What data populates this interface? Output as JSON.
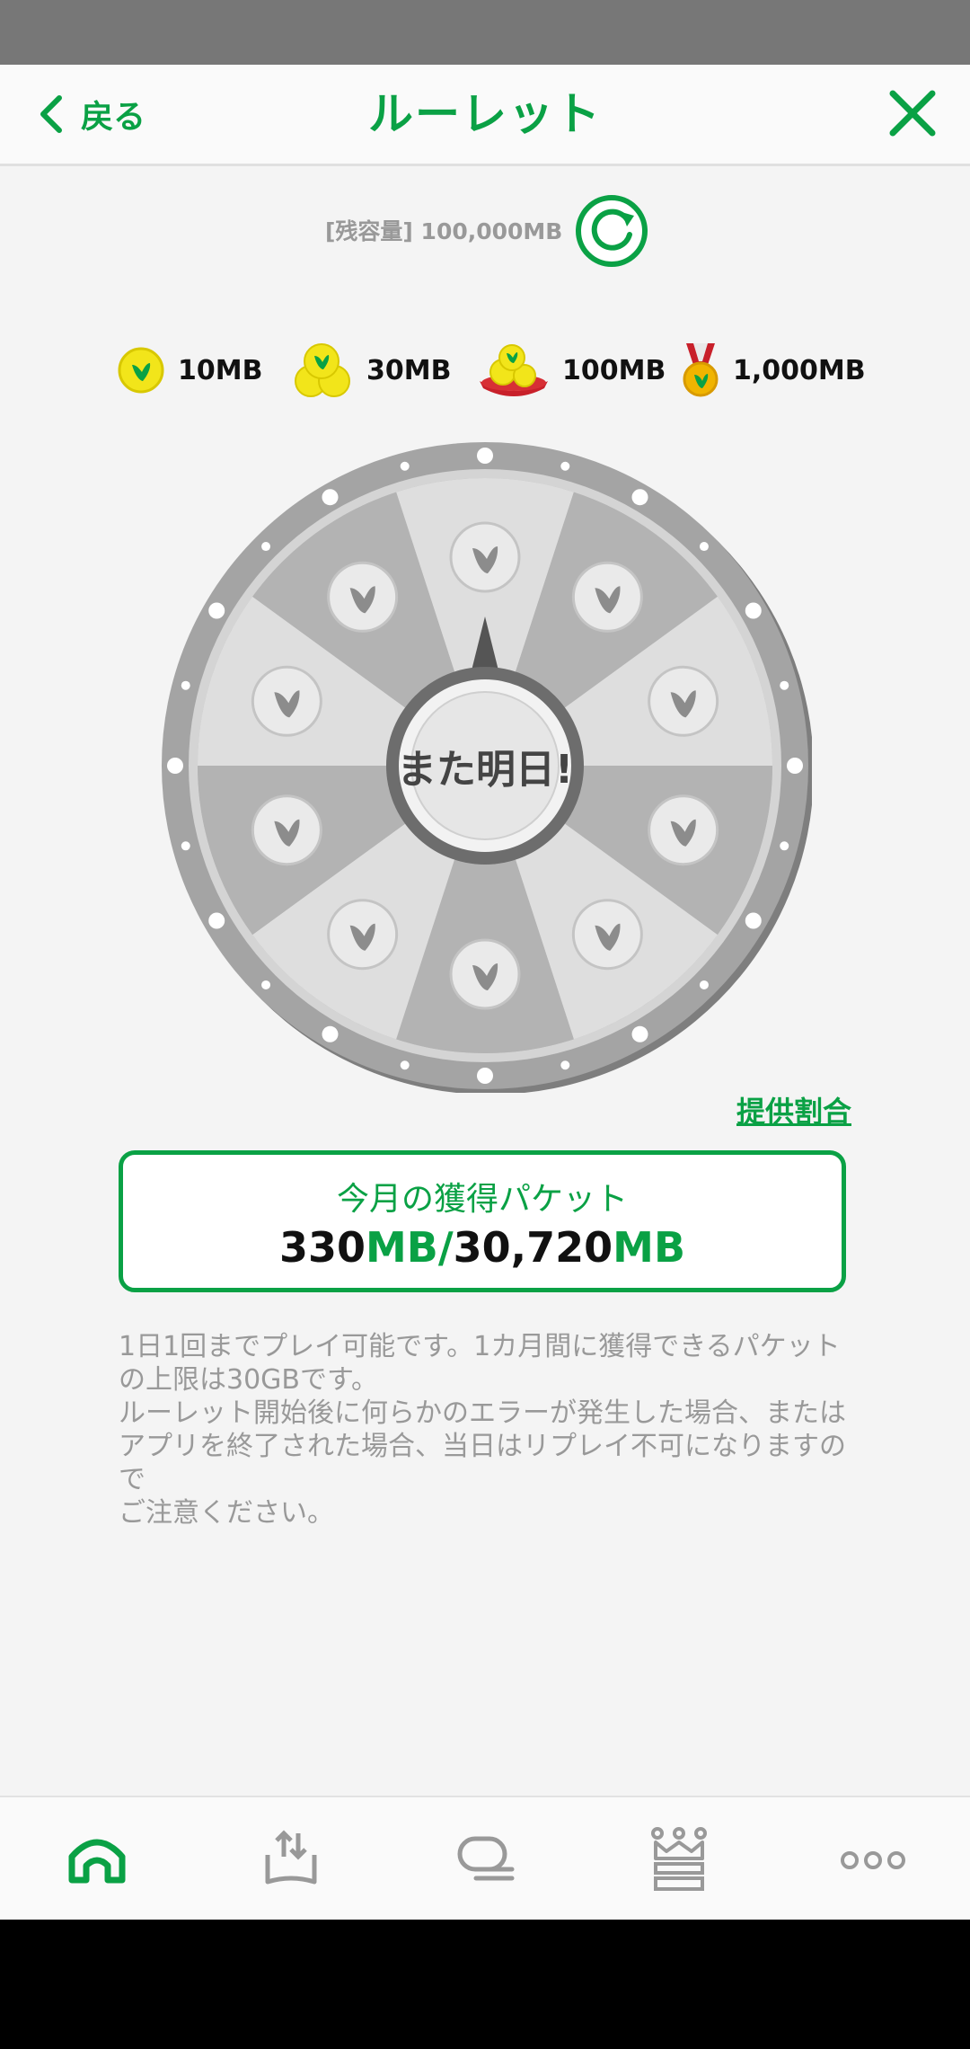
{
  "header": {
    "back_label": "戻る",
    "title": "ルーレット"
  },
  "remaining": {
    "text": "[残容量] 100,000MB"
  },
  "legend": [
    {
      "label": "10MB",
      "icon": "single-coin-icon"
    },
    {
      "label": "30MB",
      "icon": "coin-stack-icon"
    },
    {
      "label": "100MB",
      "icon": "coin-tray-icon"
    },
    {
      "label": "1,000MB",
      "icon": "medal-icon"
    }
  ],
  "wheel": {
    "center_label": "また明日!"
  },
  "odds_link": "提供割合",
  "monthly": {
    "title": "今月の獲得パケット",
    "earned": "330",
    "earned_unit": "MB/",
    "limit": "30,720",
    "limit_unit": "MB"
  },
  "notice": "1日1回までプレイ可能です。1カ月間に獲得できるパケットの上限は30GBです。\nルーレット開始後に何らかのエラーが発生した場合、またはアプリを終了された場合、当日はリプレイ不可になりますので\nご注意ください。",
  "colors": {
    "brand_green": "#0aa145",
    "coin_yellow": "#f2e51a",
    "wheel_gray": "#9a9a9a"
  }
}
